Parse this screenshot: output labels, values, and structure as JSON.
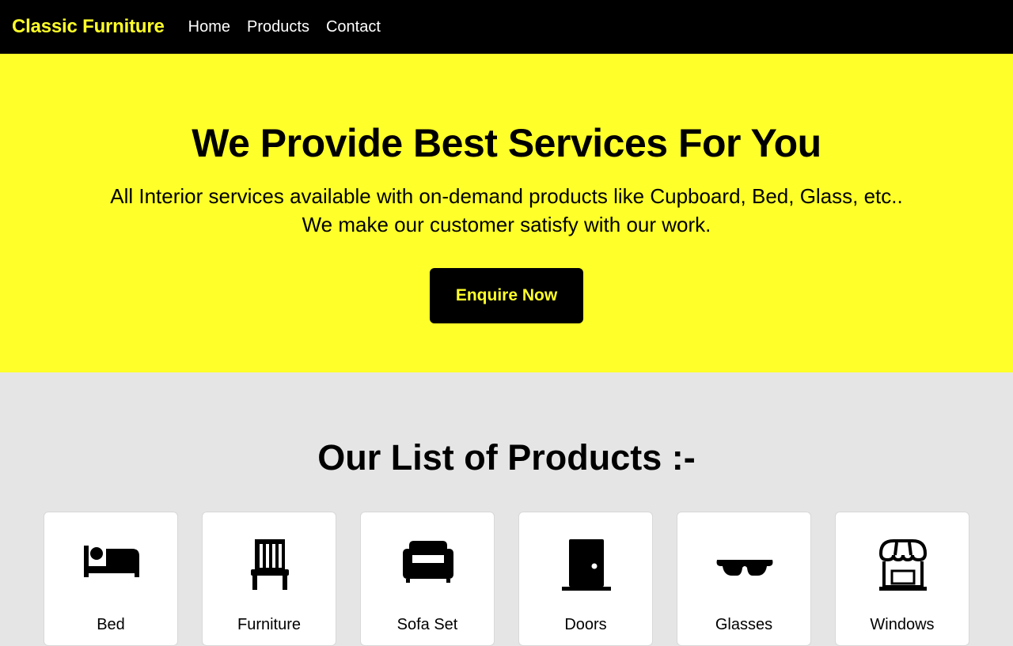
{
  "navbar": {
    "brand": "Classic Furniture",
    "links": [
      "Home",
      "Products",
      "Contact"
    ]
  },
  "hero": {
    "title": "We Provide Best Services For You",
    "line1": "All Interior services available with on-demand products like Cupboard, Bed, Glass, etc..",
    "line2": "We make our customer satisfy with our work.",
    "button": "Enquire Now"
  },
  "products": {
    "title": "Our List of Products :-",
    "items": [
      {
        "label": "Bed",
        "icon": "bed-icon"
      },
      {
        "label": "Furniture",
        "icon": "chair-icon"
      },
      {
        "label": "Sofa Set",
        "icon": "sofa-icon"
      },
      {
        "label": "Doors",
        "icon": "door-icon"
      },
      {
        "label": "Glasses",
        "icon": "glasses-icon"
      },
      {
        "label": "Windows",
        "icon": "store-icon"
      }
    ]
  },
  "colors": {
    "accent": "#ffff29",
    "nav": "#000000",
    "section_bg": "#e5e5e5"
  }
}
